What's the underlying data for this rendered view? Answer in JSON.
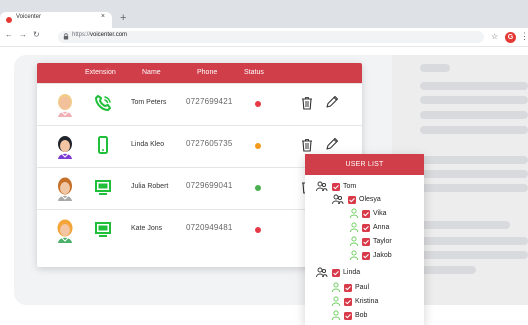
{
  "browser": {
    "tab_title": "Voicenter",
    "tab_close": "×",
    "new_tab": "+",
    "url_protocol": "https://",
    "url_host": "voicenter.com",
    "icons": [
      "back-icon",
      "forward-icon",
      "reload-icon",
      "lock-icon",
      "star-icon",
      "extension-icon",
      "menu-icon"
    ]
  },
  "table": {
    "headers": {
      "extension": "Extension",
      "name": "Name",
      "phone": "Phone",
      "status": "Status"
    },
    "rows": [
      {
        "name": "Tom Peters",
        "phone": "0727699421",
        "extension_icon": "phone-icon",
        "status_color": "#e53945"
      },
      {
        "name": "Linda Kleo",
        "phone": "0727605735",
        "extension_icon": "mobile-icon",
        "status_color": "#f39b1a"
      },
      {
        "name": "Julia Robert",
        "phone": "0729699041",
        "extension_icon": "desktop-phone-icon",
        "status_color": "#4caf50"
      },
      {
        "name": "Kate Jons",
        "phone": "0720949481",
        "extension_icon": "desktop-phone-icon",
        "status_color": "#e53945"
      }
    ]
  },
  "user_list": {
    "title": "USER LIST",
    "items": [
      {
        "label": "Tom",
        "type": "group",
        "checked": true
      },
      {
        "label": "Olesya",
        "type": "group",
        "checked": true
      },
      {
        "label": "Vika",
        "type": "user",
        "checked": true
      },
      {
        "label": "Anna",
        "type": "user",
        "checked": true
      },
      {
        "label": "Taylor",
        "type": "user",
        "checked": true
      },
      {
        "label": "Jakob",
        "type": "user",
        "checked": true
      },
      {
        "label": "Linda",
        "type": "group",
        "checked": true
      },
      {
        "label": "Paul",
        "type": "user",
        "checked": true
      },
      {
        "label": "Kristina",
        "type": "user",
        "checked": true
      },
      {
        "label": "Bob",
        "type": "user",
        "checked": true
      }
    ]
  },
  "colors": {
    "brand_red": "#cf3e49",
    "status_red": "#e53945",
    "status_orange": "#f39b1a",
    "status_green": "#4caf50",
    "extension_green": "#1fbf3a"
  }
}
